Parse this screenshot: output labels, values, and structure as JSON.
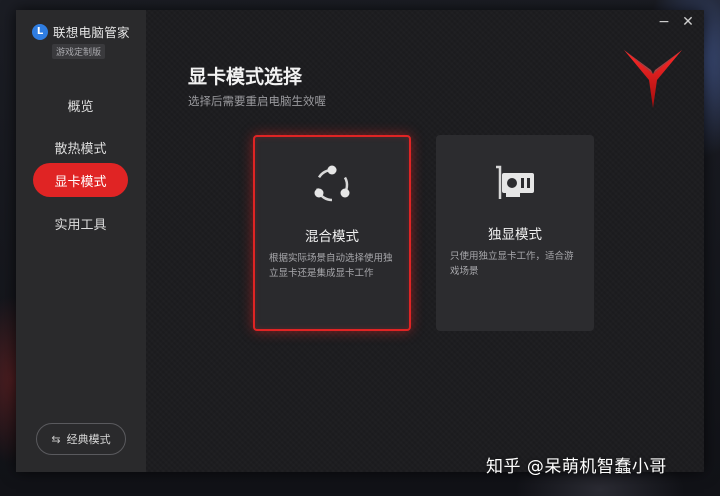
{
  "app": {
    "name": "联想电脑管家",
    "edition": "游戏定制版",
    "logo_letter": "L"
  },
  "sidebar": {
    "items": [
      {
        "label": "概览",
        "active": false
      },
      {
        "label": "散热模式",
        "active": false
      },
      {
        "label": "显卡模式",
        "active": true
      },
      {
        "label": "实用工具",
        "active": false
      }
    ],
    "classic_button": "经典模式"
  },
  "window_controls": {
    "minimize": "−",
    "close": "✕"
  },
  "main": {
    "title": "显卡模式选择",
    "subtitle": "选择后需要重启电脑生效喔",
    "cards": [
      {
        "title": "混合模式",
        "description": "根据实际场景自动选择使用独立显卡还是集成显卡工作",
        "icon": "hybrid-nodes-icon",
        "selected": true
      },
      {
        "title": "独显模式",
        "description": "只使用独立显卡工作，适合游戏场景",
        "icon": "graphics-card-icon",
        "selected": false
      }
    ]
  },
  "watermark": "知乎 @呆萌机智蠢小哥",
  "colors": {
    "accent": "#e02424",
    "sidebar_bg": "#2a2a2c",
    "main_bg": "#1d1d20",
    "card_bg": "#2c2c2f"
  }
}
